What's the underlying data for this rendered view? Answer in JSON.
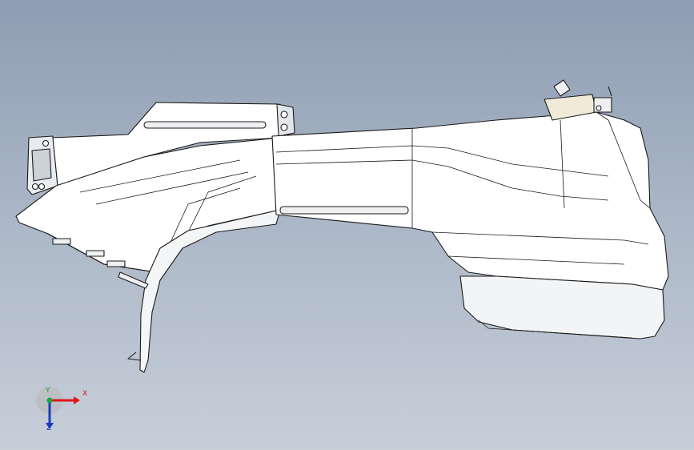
{
  "viewport": {
    "background_top": "#8e9db3",
    "background_bottom": "#c7cfd9"
  },
  "model": {
    "name_icon": "cad-sheet-metal-part",
    "fill": "#ffffff",
    "edge_color": "#1a1a1a"
  },
  "triad": {
    "x_label": "X",
    "y_label": "Y",
    "z_label": "Z",
    "x_color": "#e0141a",
    "y_color": "#1fa33a",
    "z_color": "#1b3bbf"
  }
}
